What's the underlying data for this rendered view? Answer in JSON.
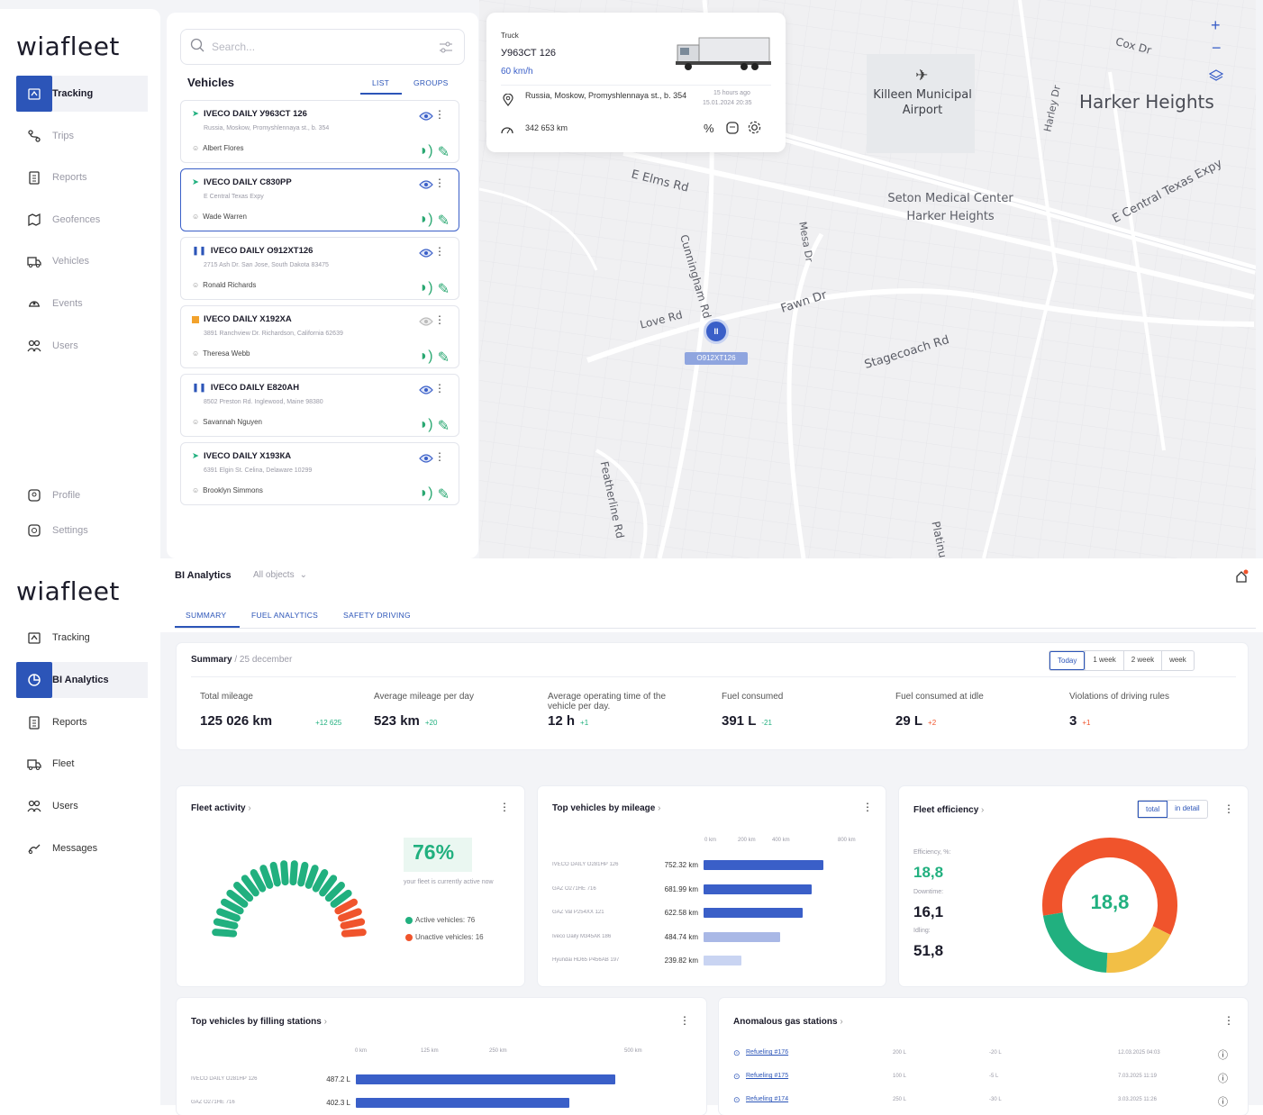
{
  "top": {
    "logo": "wiafleet",
    "nav": [
      {
        "label": "Tracking",
        "icon": "tracking-icon"
      },
      {
        "label": "Trips",
        "icon": "route-icon"
      },
      {
        "label": "Reports",
        "icon": "clipboard-icon"
      },
      {
        "label": "Geofences",
        "icon": "geofence-icon"
      },
      {
        "label": "Vehicles",
        "icon": "vehicle-icon"
      },
      {
        "label": "Events",
        "icon": "events-icon"
      },
      {
        "label": "Users",
        "icon": "users-icon"
      }
    ],
    "nav_bottom": [
      {
        "label": "Profile",
        "icon": "profile-icon"
      },
      {
        "label": "Settings",
        "icon": "settings-icon"
      }
    ],
    "search_placeholder": "Search...",
    "vehicles_title": "Vehicles",
    "tabs": [
      "LIST",
      "GROUPS"
    ],
    "vehicles": [
      {
        "name": "IVECO DAILY У963СТ 126",
        "address": "Russia, Moskow, Promyshlennaya st., b. 354",
        "driver": "Albert Flores",
        "status": "moving"
      },
      {
        "name": "IVECO DAILY С830РР",
        "address": "E Central Texas Expy",
        "driver": "Wade Warren",
        "status": "moving"
      },
      {
        "name": "IVECO DAILY О912ХТ126",
        "address": "2715 Ash Dr. San Jose, South Dakota 83475",
        "driver": "Ronald Richards",
        "status": "paused"
      },
      {
        "name": "IVECO DAILY Х192ХА",
        "address": "3891 Ranchview Dr. Richardson, California 62639",
        "driver": "Theresa Webb",
        "status": "stopped"
      },
      {
        "name": "IVECO DAILY Е820АН",
        "address": "8502 Preston Rd. Inglewood, Maine 98380",
        "driver": "Savannah Nguyen",
        "status": "paused"
      },
      {
        "name": "IVECO DAILY Х193КА",
        "address": "6391 Elgin St. Celina, Delaware 10299",
        "driver": "Brooklyn Simmons",
        "status": "moving"
      }
    ],
    "popup": {
      "type": "Truck",
      "plate": "У963СТ 126",
      "speed": "60 km/h",
      "address": "Russia, Moskow, Promyshlennaya st., b. 354",
      "ago": "15 hours ago",
      "date": "15.01.2024 20:35",
      "mileage": "342 653 km"
    },
    "map": {
      "labels": [
        "Killeen Municipal Airport",
        "Harker Heights",
        "Seton Medical Center Harker Heights",
        "E Central Texas Expy",
        "E Elms Rd",
        "Cunningham Rd",
        "Mesa Dr",
        "Fawn Dr",
        "Love Rd",
        "Stagecoach Rd",
        "Featherline Rd",
        "Cox Dr",
        "Harley Dr",
        "Platinu"
      ],
      "marker": "О912ХТ126",
      "zoom_in": "+",
      "zoom_out": "−"
    }
  },
  "bottom": {
    "logo": "wiafleet",
    "nav": [
      {
        "label": "Tracking",
        "icon": "tracking-icon"
      },
      {
        "label": "BI Analytics",
        "icon": "analytics-icon"
      },
      {
        "label": "Reports",
        "icon": "clipboard-icon"
      },
      {
        "label": "Fleet",
        "icon": "vehicle-icon"
      },
      {
        "label": "Users",
        "icon": "users-icon"
      },
      {
        "label": "Messages",
        "icon": "messages-icon"
      }
    ],
    "title": "BI Analytics",
    "filter": "All objects",
    "tabs": [
      "SUMMARY",
      "FUEL ANALYTICS",
      "SAFETY DRIVING"
    ],
    "summary": {
      "title": "Summary",
      "date": "/ 25 december",
      "periods": [
        "Today",
        "1 week",
        "2 week",
        "week"
      ],
      "metrics": [
        {
          "label": "Total mileage",
          "value": "125 026 km",
          "delta": "+12 625"
        },
        {
          "label": "Average mileage per day",
          "value": "523 km",
          "delta": "+20"
        },
        {
          "label": "Average operating time of the vehicle per day.",
          "value": "12 h",
          "delta": "+1"
        },
        {
          "label": "Fuel consumed",
          "value": "391 L",
          "delta": "-21"
        },
        {
          "label": "Fuel consumed at idle",
          "value": "29 L",
          "delta": "+2"
        },
        {
          "label": "Violations of driving rules",
          "value": "3",
          "delta": "+1"
        }
      ]
    },
    "fleet_activity": {
      "title": "Fleet activity",
      "percent": "76%",
      "caption": "your fleet is currently active now",
      "active": "Active vehicles: 76",
      "inactive": "Unactive vehicles: 16"
    },
    "top_mileage": {
      "title": "Top vehicles by mileage"
    },
    "fleet_eff": {
      "title": "Fleet efficiency",
      "buttons": [
        "total",
        "in detail"
      ],
      "eff_label": "Efficiency, %:",
      "eff": "18,8",
      "down_label": "Downtime:",
      "down": "16,1",
      "idle_label": "Idling:",
      "idle": "51,8",
      "center": "18,8"
    },
    "top_filling": {
      "title": "Top vehicles by filling stations"
    },
    "anomalous": {
      "title": "Anomalous gas stations",
      "rows": [
        {
          "name": "Refueling #176",
          "vol": "200 L",
          "diff": "-20 L",
          "date": "12.03.2025 04:03"
        },
        {
          "name": "Refueling #175",
          "vol": "100 L",
          "diff": "-5 L",
          "date": "7.03.2025 11:19"
        },
        {
          "name": "Refueling #174",
          "vol": "250 L",
          "diff": "-30 L",
          "date": "3.03.2025 11:26"
        }
      ]
    }
  },
  "chart_data": [
    {
      "type": "bar",
      "title": "Top vehicles by mileage",
      "categories": [
        "IVECO DAILY О281НР 126",
        "GAZ О271НЕ 716",
        "GAZ Val Р254ХХ 121",
        "Iveco Daily М345АК 186",
        "Hyundai HD65 Р456АВ 197"
      ],
      "values": [
        752.32,
        681.99,
        622.58,
        484.74,
        239.82
      ],
      "value_labels": [
        "752.32 km",
        "681.99 km",
        "622.58 km",
        "484.74 km",
        "239.82 km"
      ],
      "ticks": [
        "0 km",
        "200 km",
        "400 km",
        "800 km"
      ],
      "xlim": [
        0,
        1100
      ]
    },
    {
      "type": "bar",
      "title": "Top vehicles by filling stations",
      "categories": [
        "IVECO DAILY О281НР 126",
        "GAZ О271НЕ 716"
      ],
      "values": [
        487.2,
        402.3
      ],
      "value_labels": [
        "487.2 L",
        "402.3 L"
      ],
      "ticks": [
        "0 km",
        "125 km",
        "250 km",
        "500 km"
      ],
      "xlim": [
        0,
        610
      ]
    },
    {
      "type": "pie",
      "title": "Fleet efficiency",
      "categories": [
        "Efficiency",
        "Downtime",
        "Idling"
      ],
      "values": [
        18.8,
        16.1,
        51.8
      ],
      "colors": [
        "#21b07f",
        "#f2bf46",
        "#f0542c"
      ]
    },
    {
      "type": "gauge",
      "title": "Fleet activity",
      "values": [
        76,
        16
      ],
      "categories": [
        "Active vehicles",
        "Unactive vehicles"
      ],
      "colors": [
        "#21b07f",
        "#f0542c"
      ]
    }
  ]
}
